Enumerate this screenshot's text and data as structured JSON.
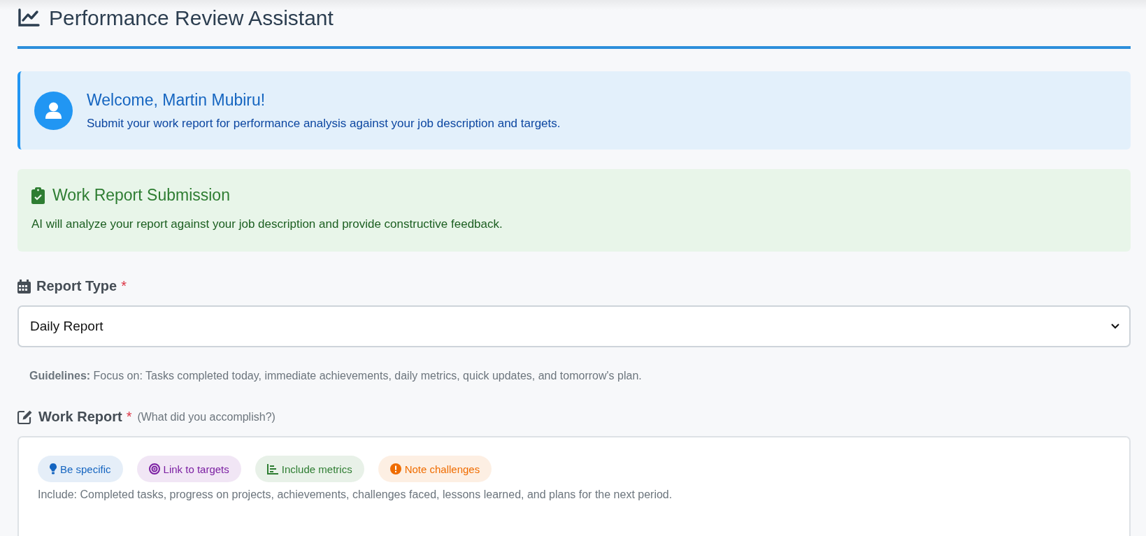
{
  "header": {
    "title": "Performance Review Assistant"
  },
  "welcome": {
    "title": "Welcome, Martin Mubiru!",
    "text": "Submit your work report for performance analysis against your job description and targets."
  },
  "notice": {
    "title": "Work Report Submission",
    "text": "AI will analyze your report against your job description and provide constructive feedback."
  },
  "report_type": {
    "label": "Report Type",
    "required_mark": "*",
    "value": "Daily Report"
  },
  "guidelines": "**Guidelines:** Focus on: Tasks completed today, immediate achievements, daily metrics, quick updates, and tomorrow's plan.",
  "work_report": {
    "label": "Work Report",
    "required_mark": "*",
    "hint": "(What did you accomplish?)",
    "tips": [
      {
        "kind": "bulb",
        "label": "Be specific",
        "color": "#1565c0"
      },
      {
        "kind": "target",
        "label": "Link to targets",
        "color": "#7b1fa2"
      },
      {
        "kind": "chart",
        "label": "Include metrics",
        "color": "#2e7d32"
      },
      {
        "kind": "alert",
        "label": "Note challenges",
        "color": "#ef6c00"
      }
    ],
    "placeholder": "Include: Completed tasks, progress on projects, achievements, challenges faced, lessons learned, and plans for the next period."
  }
}
